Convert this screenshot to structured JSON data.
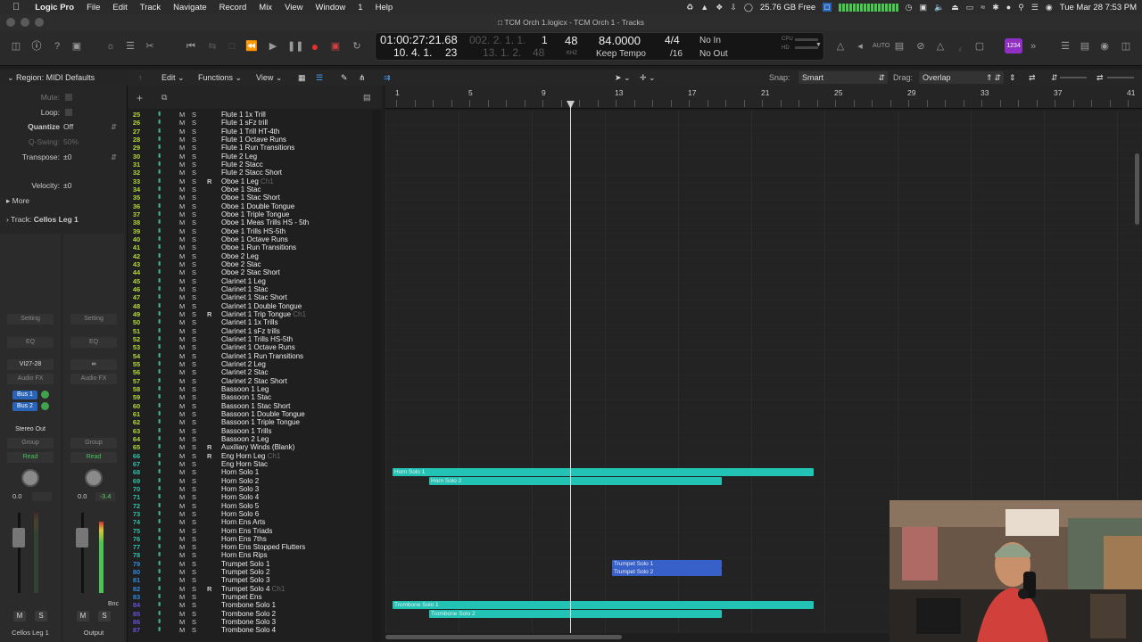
{
  "menubar": {
    "app": "Logic Pro",
    "items": [
      "File",
      "Edit",
      "Track",
      "Navigate",
      "Record",
      "Mix",
      "View",
      "Window",
      "1",
      "Help"
    ],
    "disk_free": "25.76 GB Free",
    "clock": "Tue Mar 28  7:53 PM",
    "purple_badge": "1234"
  },
  "window": {
    "title": "TCM Orch 1.logicx - TCM Orch 1 - Tracks"
  },
  "lcd": {
    "time": "01:00:27:21.68",
    "beats_dim": "002. 2. 1. 1.",
    "beats_one": "1",
    "pos1": "10. 4. 1.",
    "pos1_sub": "23",
    "pos2": "13. 1. 2.",
    "pos2_sub": "48",
    "bar_beat_a": "48",
    "tempo": "84.0000",
    "tempo_label": "Keep Tempo",
    "sig": "4/4",
    "division": "/16",
    "midi_in": "No In",
    "midi_out": "No Out",
    "cpu_label": "CPU",
    "hd_label": "HD",
    "khz_label": "KHZ"
  },
  "inspector": {
    "region_title": "Region: MIDI Defaults",
    "rows": [
      {
        "label": "Mute:",
        "value": ""
      },
      {
        "label": "Loop:",
        "value": ""
      },
      {
        "label": "Quantize",
        "value": "Off"
      },
      {
        "label": "Q-Swing:",
        "value": "50%"
      },
      {
        "label": "Transpose:",
        "value": "±0"
      },
      {
        "label": "Velocity:",
        "value": "±0"
      }
    ],
    "more_label": "More",
    "track_label": "Track:",
    "track_name": "Cellos Leg 1"
  },
  "channel_strips": [
    {
      "setting": "Setting",
      "eq": "EQ",
      "input": "VI27-28",
      "audio_fx": "Audio FX",
      "sends": [
        "Bus 1",
        "Bus 2"
      ],
      "output": "Stereo Out",
      "group": "Group",
      "automation": "Read",
      "vol": "0.0",
      "peak": "",
      "name": "Cellos Leg 1",
      "m": "M",
      "s": "S"
    },
    {
      "setting": "Setting",
      "eq": "EQ",
      "input": "∞",
      "audio_fx": "Audio FX",
      "sends": [],
      "output": "",
      "group": "Group",
      "automation": "Read",
      "vol": "0.0",
      "peak": "-3.4",
      "name": "Output",
      "m": "M",
      "s": "S",
      "bnc": "Bnc"
    }
  ],
  "editbar": {
    "edit": "Edit",
    "functions": "Functions",
    "view": "View",
    "snap_label": "Snap:",
    "snap_value": "Smart",
    "drag_label": "Drag:",
    "drag_value": "Overlap"
  },
  "ruler": {
    "bars": [
      "1",
      "5",
      "9",
      "13",
      "17",
      "21",
      "25",
      "29",
      "33",
      "37",
      "41"
    ]
  },
  "colors": {
    "track_green": "#9fd23a",
    "track_teal": "#2fbfa6",
    "track_blue": "#2f8ad9",
    "region_teal": "#22c3b4",
    "region_blue": "#3860c9",
    "accent_purple": "#8f2fc3"
  },
  "tracks": [
    {
      "n": "25",
      "name": "Flute 1 1x Trill",
      "color": "green"
    },
    {
      "n": "26",
      "name": "Flute 1 sFz trill",
      "color": "green"
    },
    {
      "n": "27",
      "name": "Flute 1 Trill HT-4th",
      "color": "green"
    },
    {
      "n": "28",
      "name": "Flute 1 Octave Runs",
      "color": "green"
    },
    {
      "n": "29",
      "name": "Flute 1 Run Transitions",
      "color": "green"
    },
    {
      "n": "30",
      "name": "Flute 2 Leg",
      "color": "green"
    },
    {
      "n": "31",
      "name": "Flute 2 Stacc",
      "color": "green"
    },
    {
      "n": "32",
      "name": "Flute 2 Stacc Short",
      "color": "green"
    },
    {
      "n": "33",
      "name": "Oboe 1 Leg",
      "color": "green",
      "r": "R",
      "sub": "Ch1"
    },
    {
      "n": "34",
      "name": "Oboe 1 Stac",
      "color": "green"
    },
    {
      "n": "35",
      "name": "Oboe 1 Stac Short",
      "color": "green"
    },
    {
      "n": "36",
      "name": "Oboe 1 Double Tongue",
      "color": "green"
    },
    {
      "n": "37",
      "name": "Oboe 1 Triple Tongue",
      "color": "green"
    },
    {
      "n": "38",
      "name": "Oboe 1 Meas Trills HS - 5th",
      "color": "green"
    },
    {
      "n": "39",
      "name": "Oboe 1 Trills HS-5th",
      "color": "green"
    },
    {
      "n": "40",
      "name": "Oboe 1 Octave Runs",
      "color": "green"
    },
    {
      "n": "41",
      "name": "Oboe 1 Run Transitions",
      "color": "green"
    },
    {
      "n": "42",
      "name": "Oboe 2 Leg",
      "color": "green"
    },
    {
      "n": "43",
      "name": "Oboe 2 Stac",
      "color": "green"
    },
    {
      "n": "44",
      "name": "Oboe 2 Stac Short",
      "color": "green"
    },
    {
      "n": "45",
      "name": "Clarinet 1 Leg",
      "color": "green"
    },
    {
      "n": "46",
      "name": "Clarinet 1 Stac",
      "color": "green"
    },
    {
      "n": "47",
      "name": "Clarinet 1 Stac Short",
      "color": "green"
    },
    {
      "n": "48",
      "name": "Clarinet 1 Double Tongue",
      "color": "green"
    },
    {
      "n": "49",
      "name": "Clarinet 1 Trip Tongue",
      "color": "green",
      "r": "R",
      "sub": "Ch1"
    },
    {
      "n": "50",
      "name": "Clarinet 1 1x Trills",
      "color": "green"
    },
    {
      "n": "51",
      "name": "Clarinet 1 sFz trills",
      "color": "green"
    },
    {
      "n": "52",
      "name": "Clarinet 1 Trills HS-5th",
      "color": "green"
    },
    {
      "n": "53",
      "name": "Clarinet 1 Octave Runs",
      "color": "green"
    },
    {
      "n": "54",
      "name": "Clarinet 1 Run Transitions",
      "color": "green"
    },
    {
      "n": "55",
      "name": "Clarinet 2 Leg",
      "color": "green"
    },
    {
      "n": "56",
      "name": "Clarinet 2 Stac",
      "color": "green"
    },
    {
      "n": "57",
      "name": "Clarinet 2 Stac Short",
      "color": "green"
    },
    {
      "n": "58",
      "name": "Bassoon 1 Leg",
      "color": "green"
    },
    {
      "n": "59",
      "name": "Bassoon 1 Stac",
      "color": "green"
    },
    {
      "n": "60",
      "name": "Bassoon 1 Stac Short",
      "color": "green"
    },
    {
      "n": "61",
      "name": "Bassoon 1 Double Tongue",
      "color": "green"
    },
    {
      "n": "62",
      "name": "Bassoon 1 Triple Tongue",
      "color": "green"
    },
    {
      "n": "63",
      "name": "Bassoon 1 Trills",
      "color": "green"
    },
    {
      "n": "64",
      "name": "Bassoon 2 Leg",
      "color": "green"
    },
    {
      "n": "65",
      "name": "Auxiliary Winds (Blank)",
      "color": "green",
      "r": "R"
    },
    {
      "n": "66",
      "name": "Eng Horn Leg",
      "color": "teal",
      "r": "R",
      "sub": "Ch1"
    },
    {
      "n": "67",
      "name": "Eng Horn Stac",
      "color": "teal"
    },
    {
      "n": "68",
      "name": "Horn Solo 1",
      "color": "teal",
      "dot": true
    },
    {
      "n": "69",
      "name": "Horn Solo 2",
      "color": "teal",
      "dot": true
    },
    {
      "n": "70",
      "name": "Horn Solo 3",
      "color": "teal"
    },
    {
      "n": "71",
      "name": "Horn Solo 4",
      "color": "teal"
    },
    {
      "n": "72",
      "name": "Horn Solo 5",
      "color": "teal"
    },
    {
      "n": "73",
      "name": "Horn Solo 6",
      "color": "teal"
    },
    {
      "n": "74",
      "name": "Horn Ens Arts",
      "color": "teal"
    },
    {
      "n": "75",
      "name": "Horn Ens Triads",
      "color": "teal"
    },
    {
      "n": "76",
      "name": "Horn Ens 7ths",
      "color": "teal"
    },
    {
      "n": "77",
      "name": "Horn Ens Stopped Flutters",
      "color": "teal"
    },
    {
      "n": "78",
      "name": "Horn Ens Rips",
      "color": "teal"
    },
    {
      "n": "79",
      "name": "Trumpet Solo 1",
      "color": "blue"
    },
    {
      "n": "80",
      "name": "Trumpet Solo 2",
      "color": "blue"
    },
    {
      "n": "81",
      "name": "Trumpet Solo 3",
      "color": "blue"
    },
    {
      "n": "82",
      "name": "Trumpet Solo 4",
      "color": "blue",
      "r": "R",
      "sub": "Ch1"
    },
    {
      "n": "83",
      "name": "Trumpet Ens",
      "color": "blue"
    },
    {
      "n": "84",
      "name": "Trombone Solo 1",
      "color": "purple",
      "dot": true
    },
    {
      "n": "85",
      "name": "Trombone Solo 2",
      "color": "purple",
      "dot": true
    },
    {
      "n": "86",
      "name": "Trombone Solo 3",
      "color": "purple"
    },
    {
      "n": "87",
      "name": "Trombone Solo 4",
      "color": "purple"
    }
  ],
  "regions": [
    {
      "track": "68",
      "label": "Horn Solo 1",
      "start_bar": 1,
      "end_bar": 24.0,
      "color": "teal"
    },
    {
      "track": "69",
      "label": "Horn Solo 2",
      "start_bar": 3.0,
      "end_bar": 19.0,
      "color": "teal"
    },
    {
      "track": "79",
      "label": "Trumpet Solo 1",
      "start_bar": 13.0,
      "end_bar": 19.0,
      "color": "blue"
    },
    {
      "track": "80",
      "label": "Trumpet Solo 2",
      "start_bar": 13.0,
      "end_bar": 19.0,
      "color": "blue"
    },
    {
      "track": "84",
      "label": "Trombone Solo 1",
      "start_bar": 1,
      "end_bar": 24.0,
      "color": "teal"
    },
    {
      "track": "85",
      "label": "Trombone Solo 2",
      "start_bar": 3.0,
      "end_bar": 19.0,
      "color": "teal"
    }
  ]
}
